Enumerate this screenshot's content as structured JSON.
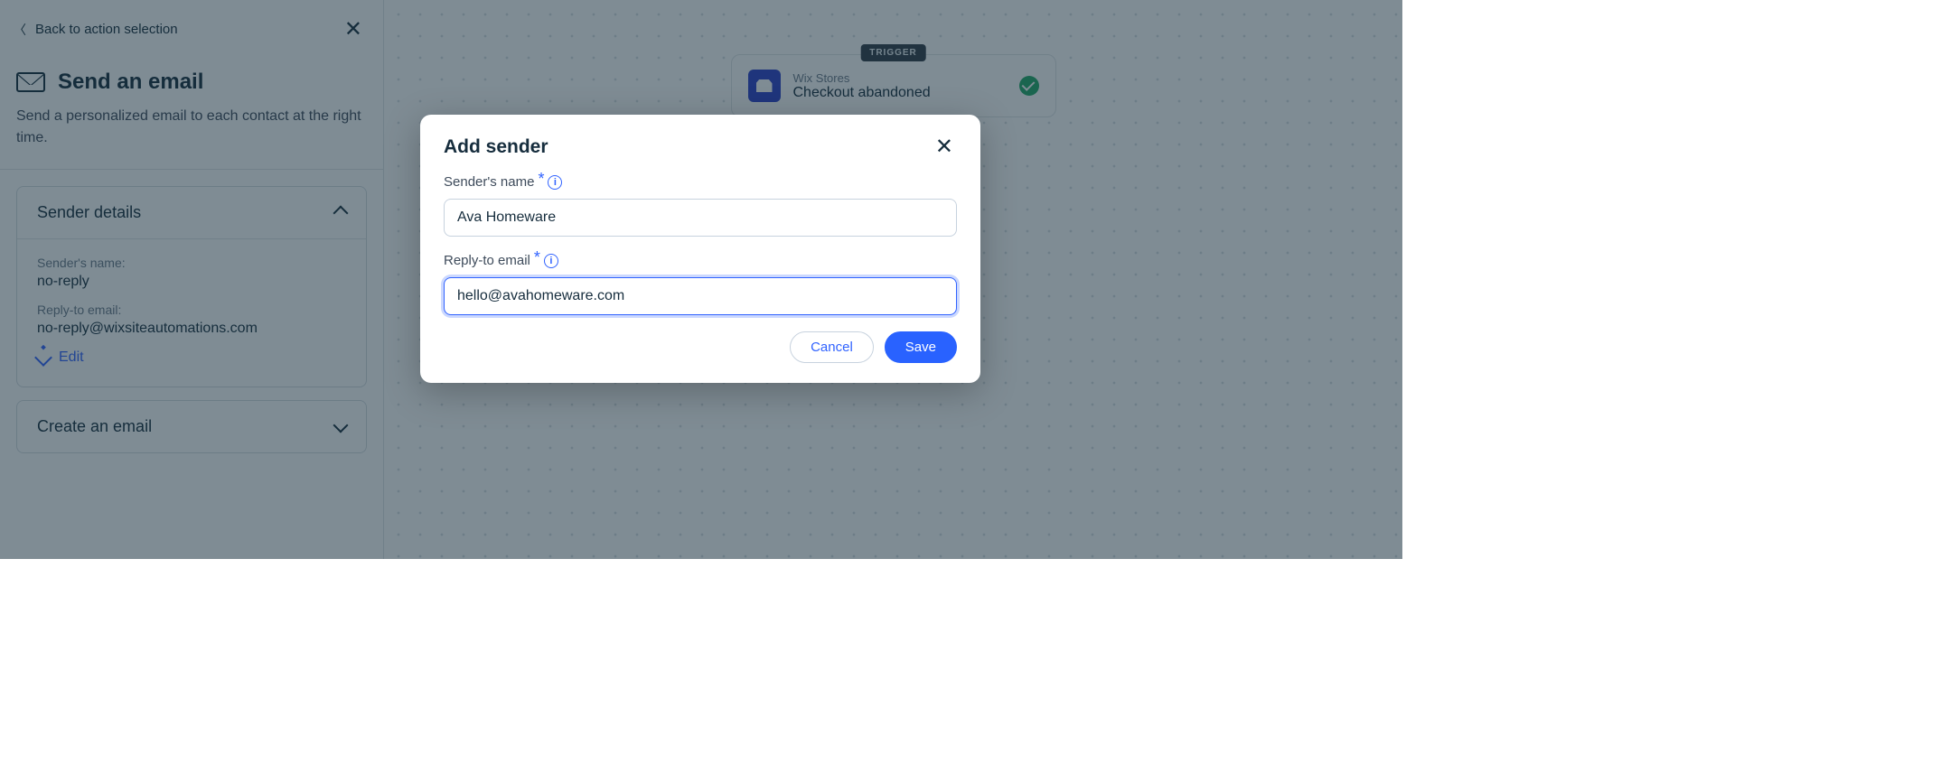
{
  "panel": {
    "back_label": "Back to action selection",
    "title": "Send an email",
    "description": "Send a personalized email to each contact at the right time.",
    "sender_details": {
      "heading": "Sender details",
      "name_label": "Sender's name:",
      "name_value": "no-reply",
      "email_label": "Reply-to email:",
      "email_value": "no-reply@wixsiteautomations.com",
      "edit_label": "Edit"
    },
    "create_email_heading": "Create an email"
  },
  "canvas": {
    "trigger_tag": "TRIGGER",
    "trigger_app": "Wix Stores",
    "trigger_name": "Checkout abandoned"
  },
  "modal": {
    "title": "Add sender",
    "name_label": "Sender's name",
    "name_value": "Ava Homeware",
    "email_label": "Reply-to email",
    "email_value": "hello@avahomeware.com",
    "cancel_label": "Cancel",
    "save_label": "Save"
  }
}
